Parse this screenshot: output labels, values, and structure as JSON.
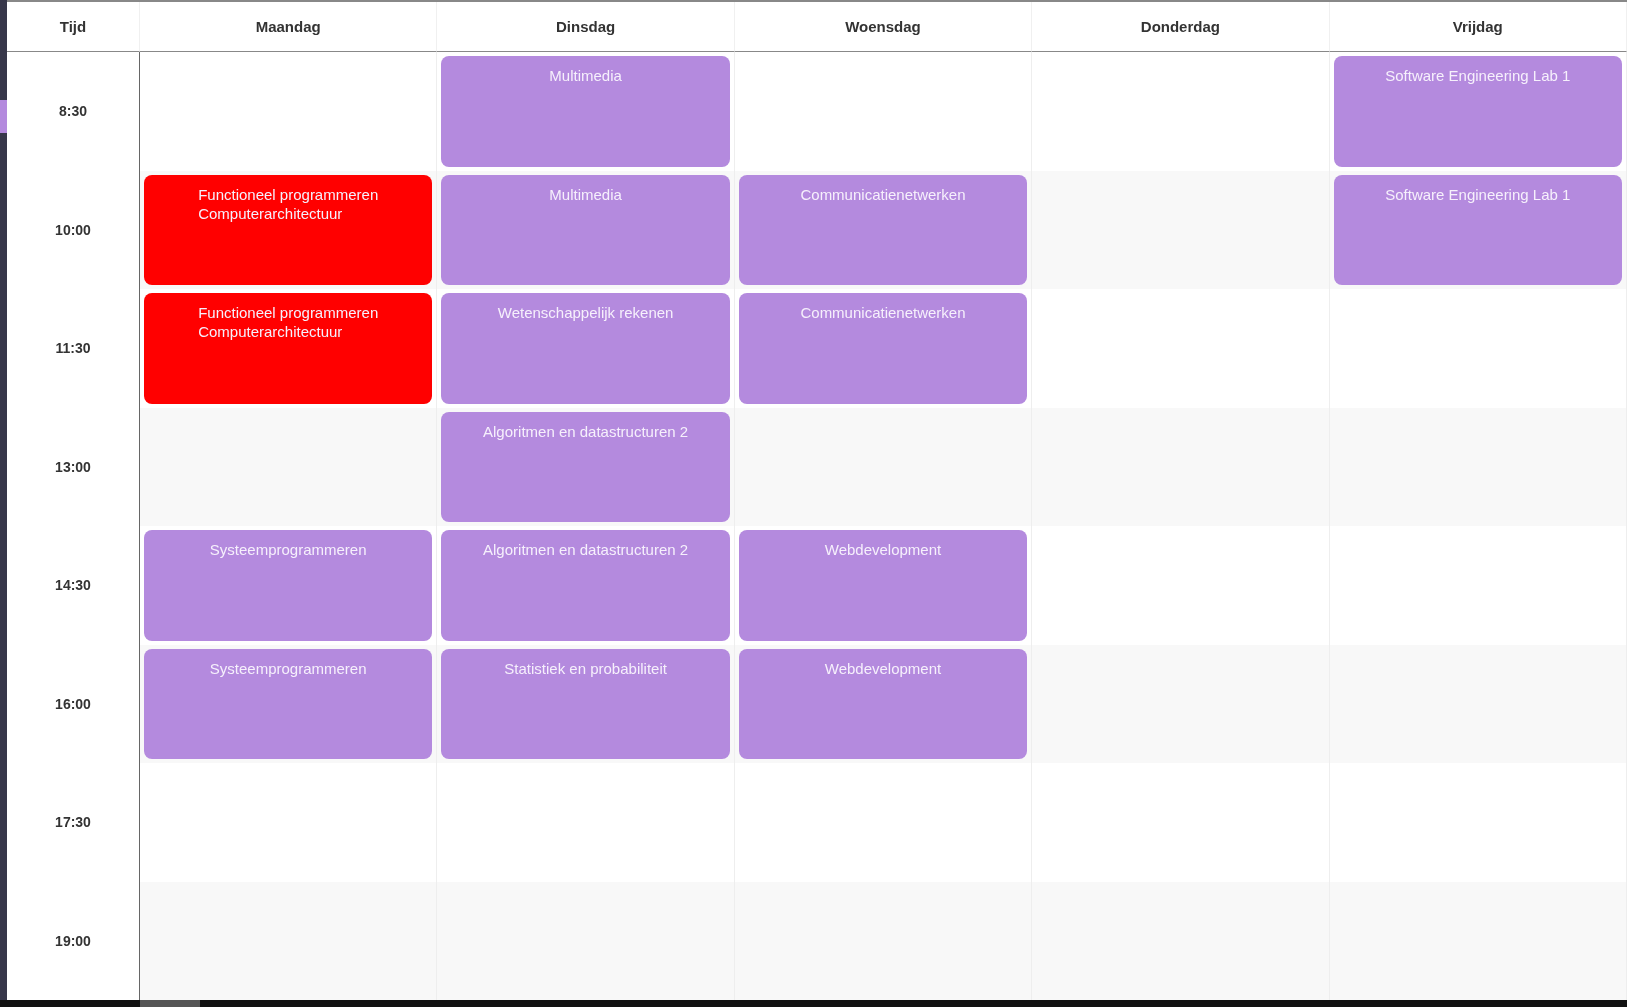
{
  "header": {
    "time_label": "Tijd",
    "days": [
      "Maandag",
      "Dinsdag",
      "Woensdag",
      "Donderdag",
      "Vrijdag"
    ]
  },
  "rows": [
    {
      "time": "8:30",
      "cells": [
        null,
        {
          "courses": [
            "Multimedia"
          ],
          "color": "#b48ade"
        },
        null,
        null,
        {
          "courses": [
            "Software Engineering Lab 1"
          ],
          "color": "#b48ade"
        }
      ]
    },
    {
      "time": "10:00",
      "cells": [
        {
          "courses": [
            "Functioneel programmeren",
            "Computerarchitectuur"
          ],
          "color": "#ff0000"
        },
        {
          "courses": [
            "Multimedia"
          ],
          "color": "#b48ade"
        },
        {
          "courses": [
            "Communicatienetwerken"
          ],
          "color": "#b48ade"
        },
        null,
        {
          "courses": [
            "Software Engineering Lab 1"
          ],
          "color": "#b48ade"
        }
      ]
    },
    {
      "time": "11:30",
      "cells": [
        {
          "courses": [
            "Functioneel programmeren",
            "Computerarchitectuur"
          ],
          "color": "#ff0000"
        },
        {
          "courses": [
            "Wetenschappelijk rekenen"
          ],
          "color": "#b48ade"
        },
        {
          "courses": [
            "Communicatienetwerken"
          ],
          "color": "#b48ade"
        },
        null,
        null
      ]
    },
    {
      "time": "13:00",
      "cells": [
        null,
        {
          "courses": [
            "Algoritmen en datastructuren 2"
          ],
          "color": "#b48ade"
        },
        null,
        null,
        null
      ]
    },
    {
      "time": "14:30",
      "cells": [
        {
          "courses": [
            "Systeemprogrammeren"
          ],
          "color": "#b48ade"
        },
        {
          "courses": [
            "Algoritmen en datastructuren 2"
          ],
          "color": "#b48ade"
        },
        {
          "courses": [
            "Webdevelopment"
          ],
          "color": "#b48ade"
        },
        null,
        null
      ]
    },
    {
      "time": "16:00",
      "cells": [
        {
          "courses": [
            "Systeemprogrammeren"
          ],
          "color": "#b48ade"
        },
        {
          "courses": [
            "Statistiek en probabiliteit"
          ],
          "color": "#b48ade"
        },
        {
          "courses": [
            "Webdevelopment"
          ],
          "color": "#b48ade"
        },
        null,
        null
      ]
    },
    {
      "time": "17:30",
      "cells": [
        null,
        null,
        null,
        null,
        null
      ]
    },
    {
      "time": "19:00",
      "cells": [
        null,
        null,
        null,
        null,
        null
      ]
    }
  ]
}
